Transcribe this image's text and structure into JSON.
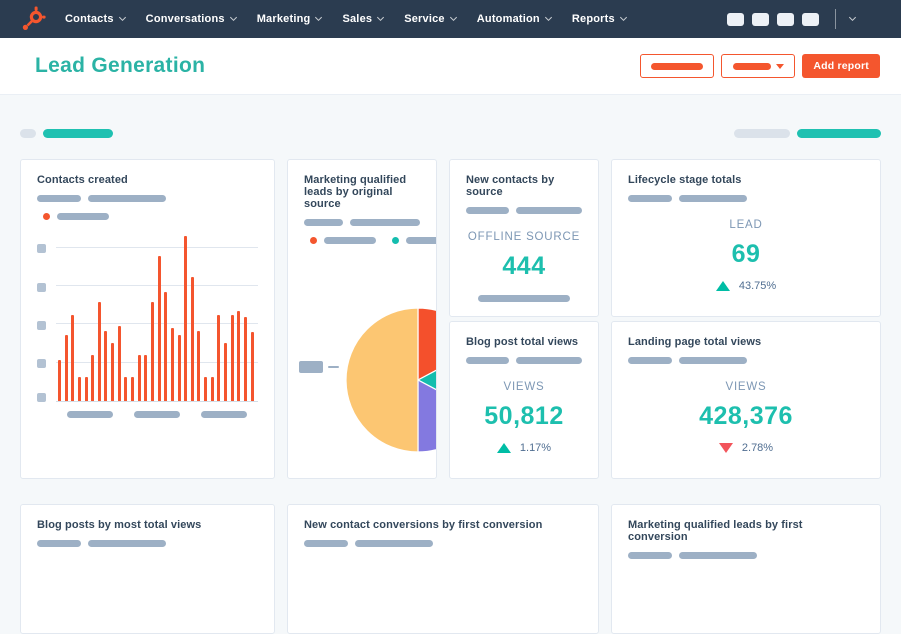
{
  "nav": {
    "items": [
      {
        "label": "Contacts"
      },
      {
        "label": "Conversations"
      },
      {
        "label": "Marketing"
      },
      {
        "label": "Sales"
      },
      {
        "label": "Service"
      },
      {
        "label": "Automation"
      },
      {
        "label": "Reports"
      }
    ],
    "right_placeholder_buttons": 4
  },
  "header": {
    "title": "Lead Generation",
    "add_report_label": "Add report"
  },
  "cards": {
    "contacts_created": {
      "title": "Contacts created"
    },
    "new_contacts_by_source": {
      "title": "New contacts by source",
      "metric_label": "OFFLINE SOURCE",
      "value": "444"
    },
    "lifecycle_stage_totals": {
      "title": "Lifecycle stage totals",
      "metric_label": "LEAD",
      "value": "69",
      "delta": "43.75%",
      "delta_direction": "up"
    },
    "mql_by_original_source": {
      "title": "Marketing qualified leads by original source"
    },
    "blog_post_total_views": {
      "title": "Blog post total views",
      "metric_label": "VIEWS",
      "value": "50,812",
      "delta": "1.17%",
      "delta_direction": "up"
    },
    "landing_page_total_views": {
      "title": "Landing page total views",
      "metric_label": "VIEWS",
      "value": "428,376",
      "delta": "2.78%",
      "delta_direction": "down"
    },
    "blog_posts_by_most_total_views": {
      "title": "Blog posts by most total views"
    },
    "new_contact_conversions_by_first_conversion": {
      "title": "New contact conversions by first conversion"
    },
    "mql_by_first_conversion": {
      "title": "Marketing qualified leads by first conversion"
    }
  },
  "chart_data": [
    {
      "type": "bar",
      "card": "contacts_created",
      "title": "Contacts created",
      "bar_color": "#f4552e",
      "note": "axis tick and category labels are skeleton placeholders; values estimated relative to gridline span (1.0 = top gridline)",
      "values": [
        0.27,
        0.43,
        0.56,
        0.16,
        0.16,
        0.3,
        0.65,
        0.46,
        0.38,
        0.49,
        0.16,
        0.16,
        0.3,
        0.3,
        0.65,
        0.95,
        0.71,
        0.48,
        0.43,
        1.08,
        0.81,
        0.46,
        0.16,
        0.16,
        0.56,
        0.38,
        0.56,
        0.59,
        0.55,
        0.45
      ],
      "gridlines": 4,
      "x_label_placeholders": 3,
      "y_tick_placeholders": 5
    },
    {
      "type": "pie",
      "card": "mql_by_original_source",
      "title": "Marketing qualified leads by original source",
      "note": "slice labels are skeleton placeholders",
      "slices": [
        {
          "name": "slice-1",
          "pct": 17.2,
          "color": "#f4502c"
        },
        {
          "name": "slice-2",
          "pct": 15.6,
          "color": "#14bdae"
        },
        {
          "name": "slice-3",
          "pct": 17.2,
          "color": "#8379e0"
        },
        {
          "name": "slice-4",
          "pct": 50.0,
          "color": "#fcc672"
        }
      ],
      "legend_colors": [
        "#f4562e",
        "#14bdae",
        "#8379e0"
      ],
      "legend_position": "top"
    }
  ],
  "colors": {
    "navbar_bg": "#2b3c50",
    "accent_orange": "#f4562e",
    "teal_text": "#1dbfae",
    "title_teal": "#2bb3a5",
    "delta_up": "#00bda5",
    "delta_down": "#f2545b",
    "skeleton_blue": "#9db0c5",
    "skeleton_gray": "#dbe2ea",
    "skeleton_teal": "#1fc1b1",
    "page_bg": "#f5f8fa"
  }
}
